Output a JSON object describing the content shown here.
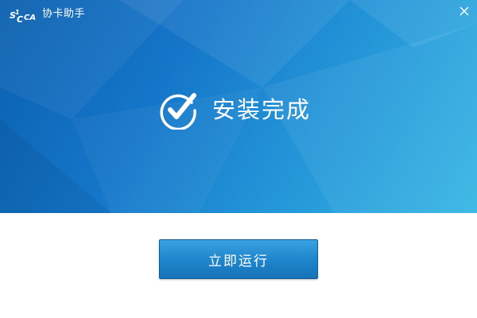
{
  "window": {
    "app_title": "协卡助手",
    "logo_icon": "scca-logo-icon",
    "close_icon": "close-icon"
  },
  "status": {
    "icon": "check-circle-icon",
    "text": "安装完成"
  },
  "actions": {
    "run_now_label": "立即运行"
  },
  "colors": {
    "banner_dark": "#0a5fae",
    "banner_light": "#35b6e4",
    "button_top": "#3aa2e0",
    "button_bottom": "#1673b9",
    "background": "#ffffff"
  }
}
